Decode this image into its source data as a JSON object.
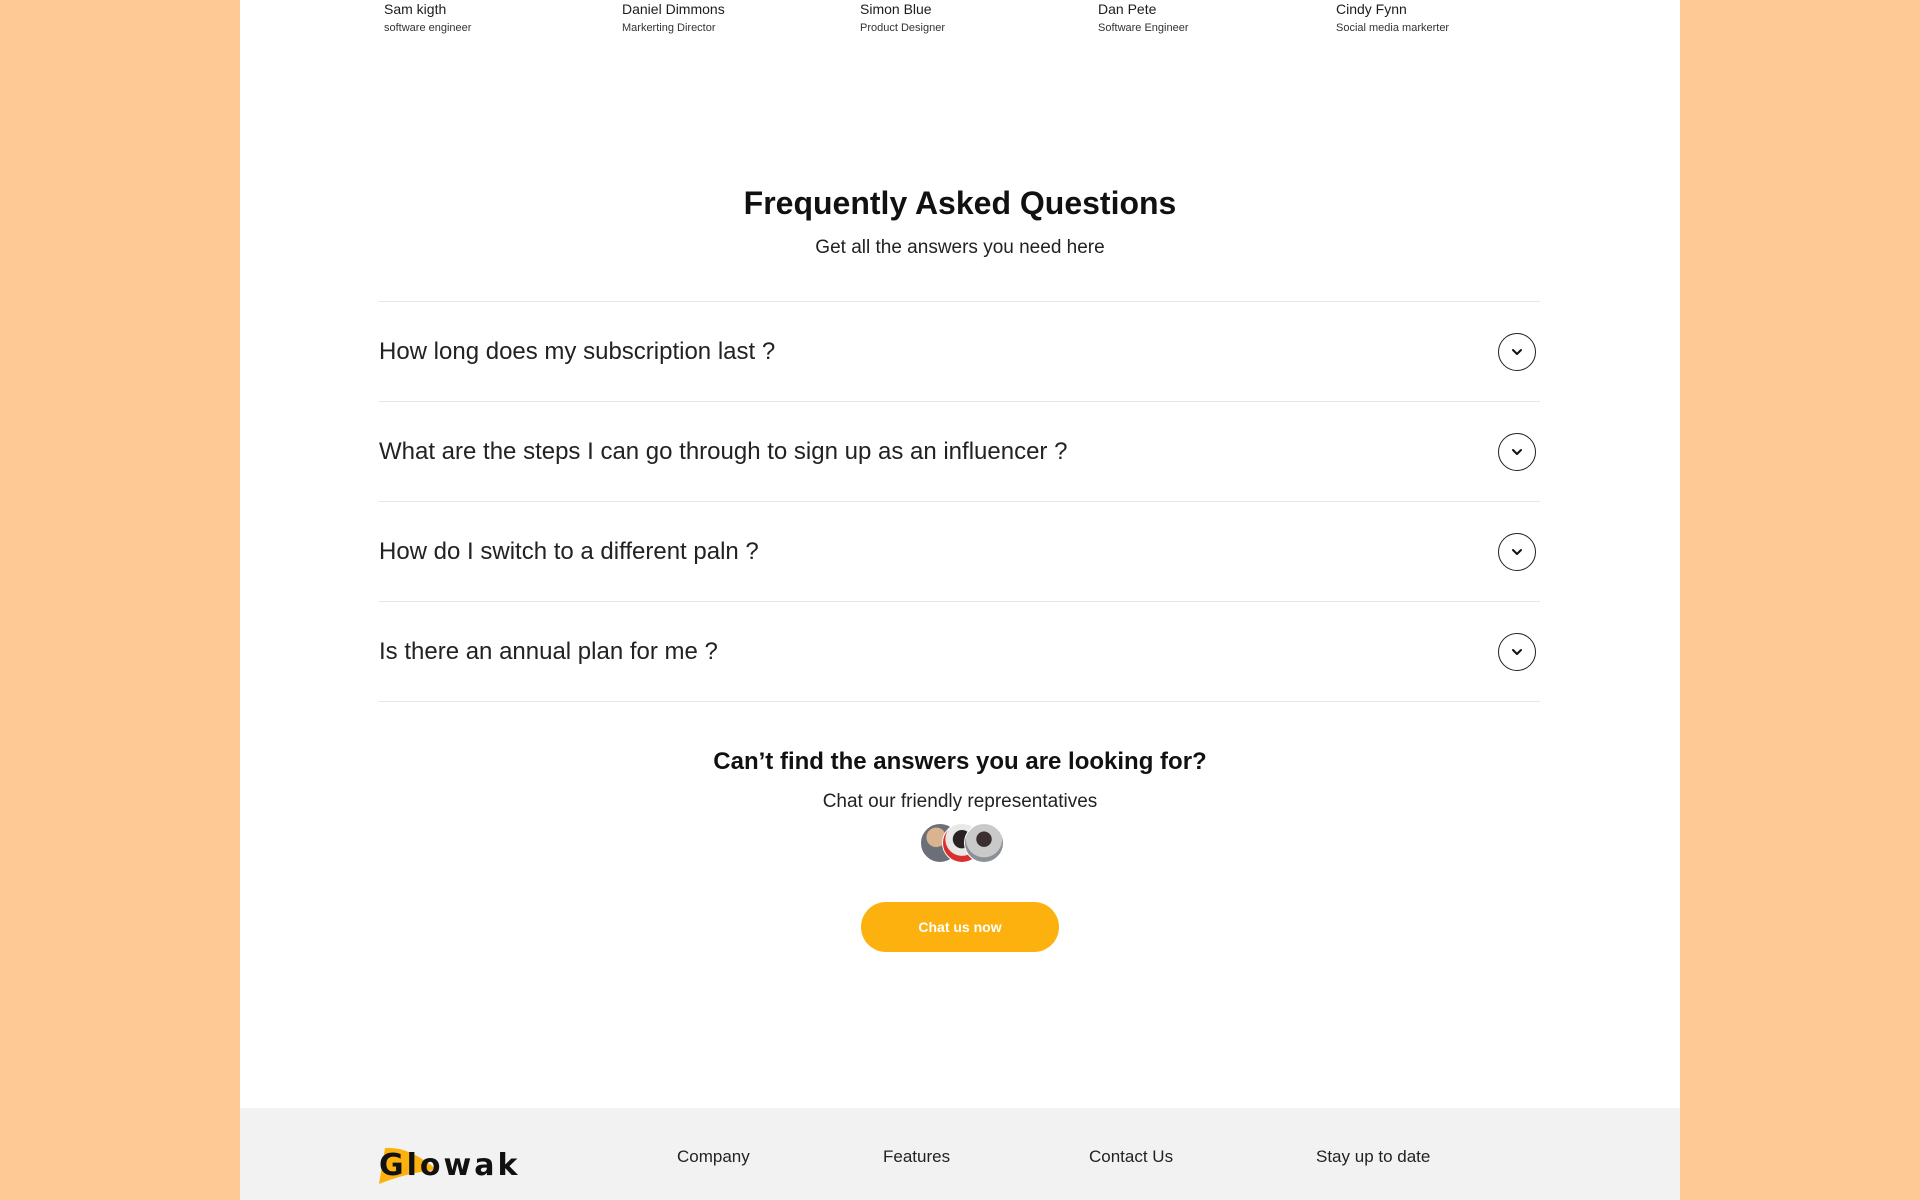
{
  "team": [
    {
      "name": "Sam kigth",
      "role": "software engineer"
    },
    {
      "name": "Daniel Dimmons",
      "role": "Markerting Director"
    },
    {
      "name": "Simon Blue",
      "role": "Product Designer"
    },
    {
      "name": "Dan Pete",
      "role": "Software Engineer"
    },
    {
      "name": "Cindy Fynn",
      "role": "Social media markerter"
    }
  ],
  "faq": {
    "title": "Frequently Asked Questions",
    "subtitle": "Get all the answers you need here",
    "items": [
      {
        "question": "How long does my subscription last ?"
      },
      {
        "question": "What are the steps I can go through to sign up as an influencer ?"
      },
      {
        "question": "How do I switch to a different paln ?"
      },
      {
        "question": "Is there an annual plan for me ?"
      }
    ]
  },
  "cta": {
    "title": "Can’t find the answers you are looking for?",
    "subtitle": "Chat our friendly representatives",
    "button_label": "Chat us now"
  },
  "footer": {
    "logo_text": "Glowak",
    "columns": [
      "Company",
      "Features",
      "Contact Us",
      "Stay up to date"
    ]
  },
  "colors": {
    "page_background": "#fec994",
    "accent": "#fdb10f",
    "footer_background": "#f2f2f2"
  },
  "icons": [
    "chevron-down-icon",
    "avatar-photo"
  ]
}
